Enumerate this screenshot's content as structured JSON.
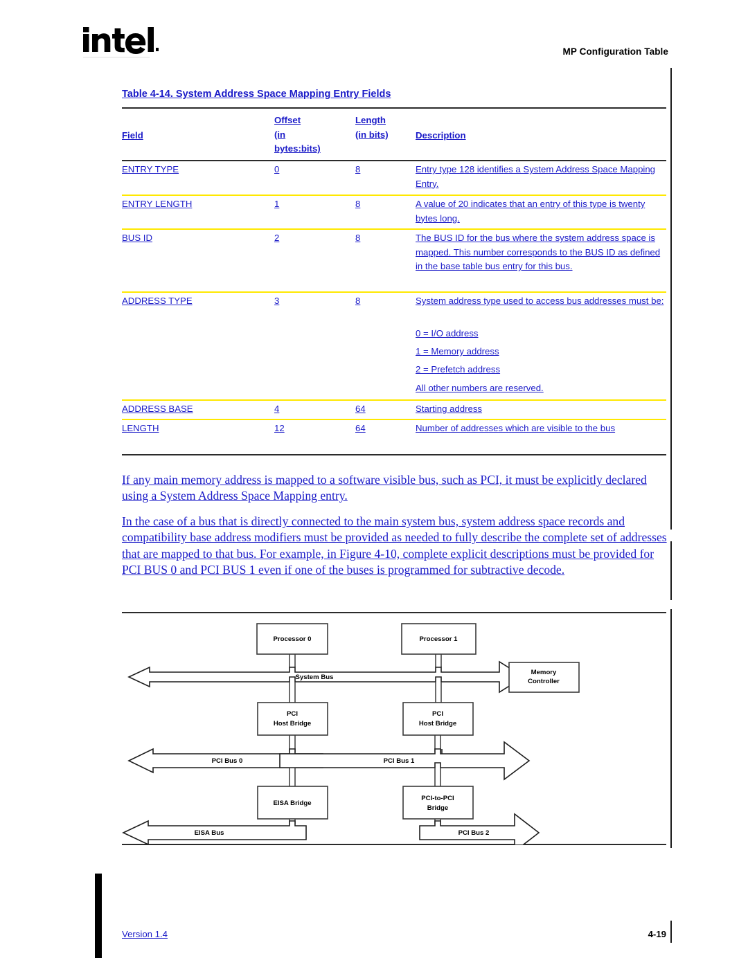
{
  "header": {
    "logo": "intel-logo",
    "running_title": "MP Configuration Table"
  },
  "table": {
    "caption": "Table 4-14.  System Address Space Mapping Entry Fields",
    "columns": [
      {
        "id": "field",
        "label": "Field"
      },
      {
        "id": "offset",
        "label": "Offset\n(in\nbytes:bits)",
        "label_lines": [
          "Offset",
          "(in",
          "bytes:bits)"
        ]
      },
      {
        "id": "length",
        "label": "Length\n(in bits)",
        "label_lines": [
          "Length",
          "(in bits)"
        ]
      },
      {
        "id": "description",
        "label": "Description"
      }
    ],
    "rows": [
      {
        "field": "ENTRY TYPE",
        "offset": "0",
        "length": "8",
        "description": "Entry type 128 identifies a System Address Space Mapping Entry."
      },
      {
        "field": "ENTRY LENGTH",
        "offset": "1",
        "length": "8",
        "description": "A value of 20 indicates that an entry of this type is twenty bytes long."
      },
      {
        "field": "BUS ID",
        "offset": "2",
        "length": "8",
        "description": "The BUS ID for the bus where the system address space is mapped.  This number corresponds to the BUS ID as defined in the base table bus entry for this bus."
      },
      {
        "field": "ADDRESS TYPE",
        "offset": "3",
        "length": "8",
        "description": "System address type used to access bus addresses must be:",
        "description_extra": [
          "  0 = I/O address",
          "  1 = Memory address",
          "  2 = Prefetch address",
          "All other numbers are reserved."
        ]
      },
      {
        "field": "ADDRESS BASE",
        "offset": "4",
        "length": "64",
        "description": "Starting address"
      },
      {
        "field": "LENGTH",
        "offset": "12",
        "length": "64",
        "description": "Number of addresses which are visible to the bus"
      }
    ]
  },
  "body": {
    "paragraph_1": "If any main memory address is mapped to a software visible bus, such as PCI, it must be explicitly declared using a System Address Space Mapping entry.",
    "paragraph_2": "In the case of a bus that is directly connected to the main system bus, system address space records and compatibility base address modifiers must be provided as needed to fully describe the complete set of addresses that are mapped to that bus.  For example, in Figure 4-10, complete explicit descriptions must be provided for PCI BUS 0 and PCI BUS 1 even if one of the buses is programmed for subtractive decode."
  },
  "figure": {
    "boxes": {
      "processor_0": "Processor 0",
      "processor_1": "Processor 1",
      "memory_controller_line1": "Memory",
      "memory_controller_line2": "Controller",
      "pci_host_bridge_0_line1": "PCI",
      "pci_host_bridge_0_line2": "Host Bridge",
      "pci_host_bridge_1_line1": "PCI",
      "pci_host_bridge_1_line2": "Host Bridge",
      "eisa_bridge": "EISA Bridge",
      "pci_to_pci_bridge_line1": "PCI-to-PCI",
      "pci_to_pci_bridge_line2": "Bridge"
    },
    "buses": {
      "system_bus": "System Bus",
      "pci_bus_0": "PCI Bus 0",
      "pci_bus_1": "PCI Bus 1",
      "eisa_bus": "EISA Bus",
      "pci_bus_2": "PCI Bus 2"
    }
  },
  "footer": {
    "version": "Version 1.4",
    "page_number": "4-19"
  },
  "colors": {
    "link_blue": "#1b1bc8",
    "rule_dark": "#2b2b2b",
    "rule_yellow": "#ffe800",
    "text_black": "#000000"
  }
}
